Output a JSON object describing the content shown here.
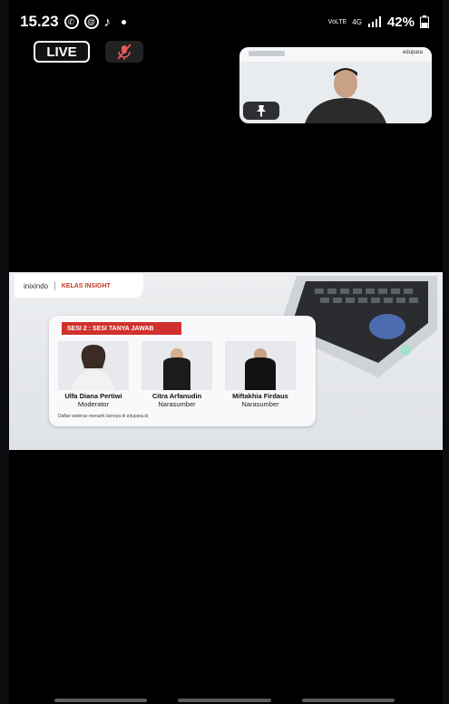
{
  "status": {
    "time": "15.23",
    "network_volte": "VoLTE",
    "network_4g": "4G",
    "battery": "42%"
  },
  "live": {
    "label": "LIVE"
  },
  "pip": {
    "brand": "edupara"
  },
  "slide": {
    "logo_left": "inixindo",
    "logo_right": "KELAS INSIGHT",
    "session_title": "SESI 2 : SESI TANYA JAWAB",
    "speakers": [
      {
        "name": "Ulfa Diana Pertiwi",
        "role": "Moderator"
      },
      {
        "name": "Citra Arfanudin",
        "role": "Narasumber"
      },
      {
        "name": "Miftakhia Firdaus",
        "role": "Narasumber"
      }
    ],
    "footer": "Daftar webinar menarik lainnya di edupara.id"
  }
}
